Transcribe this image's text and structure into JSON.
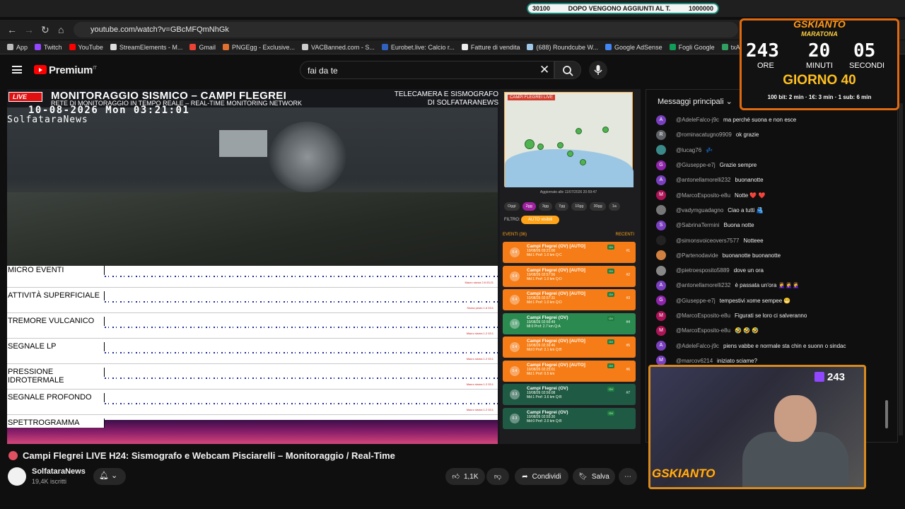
{
  "ticker": {
    "left": "30100",
    "center": "DOPO VENGONO AGGIUNTI AL T.",
    "right": "1000000"
  },
  "browser": {
    "url": "youtube.com/watch?v=GBcMFQmNhGk",
    "bookmarks": [
      {
        "label": "App",
        "color": "#bbbbbb"
      },
      {
        "label": "Twitch",
        "color": "#9146ff"
      },
      {
        "label": "YouTube",
        "color": "#ff0000"
      },
      {
        "label": "StreamElements - M...",
        "color": "#dddddd"
      },
      {
        "label": "Gmail",
        "color": "#ea4335"
      },
      {
        "label": "PNGEgg - Exclusive...",
        "color": "#e07030"
      },
      {
        "label": "VACBanned.com - S...",
        "color": "#cccccc"
      },
      {
        "label": "Eurobet.live: Calcio r...",
        "color": "#3060c0"
      },
      {
        "label": "Fatture di vendita",
        "color": "#eeeeee"
      },
      {
        "label": "(688) Roundcube W...",
        "color": "#a0c8e8"
      },
      {
        "label": "Google AdSense",
        "color": "#4285f4"
      },
      {
        "label": "Fogli Google",
        "color": "#0f9d58"
      },
      {
        "label": "txAdmin",
        "color": "#30a060"
      }
    ]
  },
  "youtube": {
    "brand": "Premium",
    "region": "IT",
    "search_value": "fai da te"
  },
  "stream": {
    "live_badge": "LIVE",
    "title": "MONITORAGGIO SISMICO – CAMPI FLEGREI",
    "subtitle": "RETE DI MONITORAGGIO IN TEMPO REALE – REAL-TIME MONITORING NETWORK",
    "right_line1": "TELECAMERA E SISMOGRAFO",
    "right_line2": "DI SOLFATARANEWS",
    "cam_timestamp": "10-08-2026 Mon 03:21:01",
    "cam_source": "SolfataraNews",
    "rows": [
      {
        "label": "MICRO EVENTI",
        "note": "Macro sisma 2.8 03:21"
      },
      {
        "label": "ATTIVITÀ SUPERFICIALE",
        "note": "Sisma pesto 1.6 03:1"
      },
      {
        "label": "TREMORE VULCANICO",
        "note": "Macro sisma 1.2 03:1"
      },
      {
        "label": "SEGNALE LP",
        "note": "Macro sisma 1.2 03:1"
      },
      {
        "label": "PRESSIONE IDROTERMALE",
        "note": "Macro sisma 1.2 03:1"
      },
      {
        "label": "SEGNALE PROFONDO",
        "note": "Macro sisma 1.2 03:1"
      }
    ],
    "spectro_label": "SPETTROGRAMMA"
  },
  "panel": {
    "map_label": "CAMPI FLEGREI LIVE",
    "updated": "Aggiornato alle 11/07/2026 20:59:47",
    "chips": [
      "Oggi",
      "2gg",
      "3gg",
      "7gg",
      "10gg",
      "30gg",
      "1a"
    ],
    "active_chip": "2gg",
    "filter_label": "FILTRO:",
    "filter_button": "AUTO visibili",
    "events_header": "EVENTI (36)",
    "events_recent": "RECENTI",
    "events": [
      {
        "title": "Campi Flegrei (OV) [AUTO]",
        "time": "10/08/26 03:21:00",
        "detail": "Md:1  Prof: 1.0 km Q:C",
        "mag": "0.4",
        "num": "#1",
        "style": "o"
      },
      {
        "title": "Campi Flegrei (OV) [AUTO]",
        "time": "10/08/26 02:57:56",
        "detail": "Md:1  Prof: 1.0 km Q:D",
        "mag": "0.4",
        "num": "#2",
        "style": "o"
      },
      {
        "title": "Campi Flegrei (OV) [AUTO]",
        "time": "10/08/26 02:57:31",
        "detail": "Md:1  Prof: 1.0 km Q:D",
        "mag": "0.4",
        "num": "#3",
        "style": "o"
      },
      {
        "title": "Campi Flegrei (OV)",
        "time": "10/08/26 02:56:49",
        "detail": "Ml:0  Prof: 2.7 km Q:A",
        "mag": "1.0",
        "num": "#4",
        "style": "g"
      },
      {
        "title": "Campi Flegrei (OV) [AUTO]",
        "time": "10/08/26 02:36:46",
        "detail": "Md:0  Prof: 2.1 km Q:B",
        "mag": "0.4",
        "num": "#5",
        "style": "o"
      },
      {
        "title": "Campi Flegrei (OV) [AUTO]",
        "time": "10/08/26 02:25:01",
        "detail": "Md:1  Prof: 0.5 km",
        "mag": "0.4",
        "num": "#6",
        "style": "o"
      },
      {
        "title": "Campi Flegrei (OV)",
        "time": "10/08/26 02:56:08",
        "detail": "Md:1  Prof: 3.6 km Q:B",
        "mag": "0.3",
        "num": "#7",
        "style": "d"
      },
      {
        "title": "Campi Flegrei (OV)",
        "time": "10/08/26 02:55:30",
        "detail": "Md:0  Prof: 2.0 km Q:B",
        "mag": "0.3",
        "num": "",
        "style": "d"
      }
    ]
  },
  "video": {
    "title": "Campi Flegrei LIVE H24: Sismografo e Webcam Pisciarelli – Monitoraggio / Real-Time",
    "channel": "SolfataraNews",
    "subscribers": "19,4K iscritti",
    "likes": "1,1K",
    "share": "Condividi",
    "save": "Salva"
  },
  "chat": {
    "header": "Messaggi principali",
    "messages": [
      {
        "author": "@AdeleFalco-j9c",
        "text": "ma perché suona e non esce",
        "initial": "A",
        "color": "#7a3fbf"
      },
      {
        "author": "@rominacatugno9909",
        "text": "ok grazie",
        "initial": "R",
        "color": "#5f6368"
      },
      {
        "author": "@lucag76",
        "text": "💤",
        "initial": "",
        "color": "#3a8a8a"
      },
      {
        "author": "@Giuseppe-e7j",
        "text": "Grazie sempre",
        "initial": "G",
        "color": "#8e24aa"
      },
      {
        "author": "@antonellamorelli232",
        "text": "buonanotte",
        "initial": "A",
        "color": "#7a3fbf"
      },
      {
        "author": "@MarcoEsposito-e8u",
        "text": "Notte ❤️ ❤️",
        "initial": "M",
        "color": "#ad1457"
      },
      {
        "author": "@vadymguadagno",
        "text": "Ciao a tutti 🫂",
        "initial": "",
        "color": "#777777"
      },
      {
        "author": "@SabrinaTermini",
        "text": "Buona notte",
        "initial": "S",
        "color": "#7a3fbf"
      },
      {
        "author": "@simonsvoiceovers7577",
        "text": "Notteee",
        "initial": "",
        "color": "#222222"
      },
      {
        "author": "@Partenodavide",
        "text": "buonanotte buonanotte",
        "initial": "",
        "color": "#d08040"
      },
      {
        "author": "@pietroesposito5889",
        "text": "dove un ora",
        "initial": "",
        "color": "#888888"
      },
      {
        "author": "@antonellamorelli232",
        "text": "è passata un'ora 🤦‍♀️🤦‍♀️🤦‍♀️",
        "initial": "A",
        "color": "#7a3fbf"
      },
      {
        "author": "@Giuseppe-e7j",
        "text": "tempestivi xome sempee 😬",
        "initial": "G",
        "color": "#8e24aa"
      },
      {
        "author": "@MarcoEsposito-e8u",
        "text": "Figurati se loro ci salveranno",
        "initial": "M",
        "color": "#ad1457"
      },
      {
        "author": "@MarcoEsposito-e8u",
        "text": "🤣 🤣 🤣",
        "initial": "M",
        "color": "#ad1457"
      },
      {
        "author": "@AdeleFalco-j9c",
        "text": "piens vabbe e normale sta chin e suonn o sindac",
        "initial": "A",
        "color": "#7a3fbf"
      },
      {
        "author": "@marcov6214",
        "text": "iniziato sciame?",
        "initial": "M",
        "color": "#7a3fbf"
      }
    ]
  },
  "overlay": {
    "brand": "GSKIANTO",
    "sub": "MARATONA",
    "hours": "243",
    "minutes": "20",
    "seconds": "05",
    "hours_label": "ORE",
    "minutes_label": "MINUTI",
    "seconds_label": "SECONDI",
    "day": "GIORNO 40",
    "info": "100 bit: 2 min · 1€: 3 min · 1 sub: 6 min"
  },
  "webcam": {
    "viewers": "243",
    "logo": "GSKIANTO"
  }
}
